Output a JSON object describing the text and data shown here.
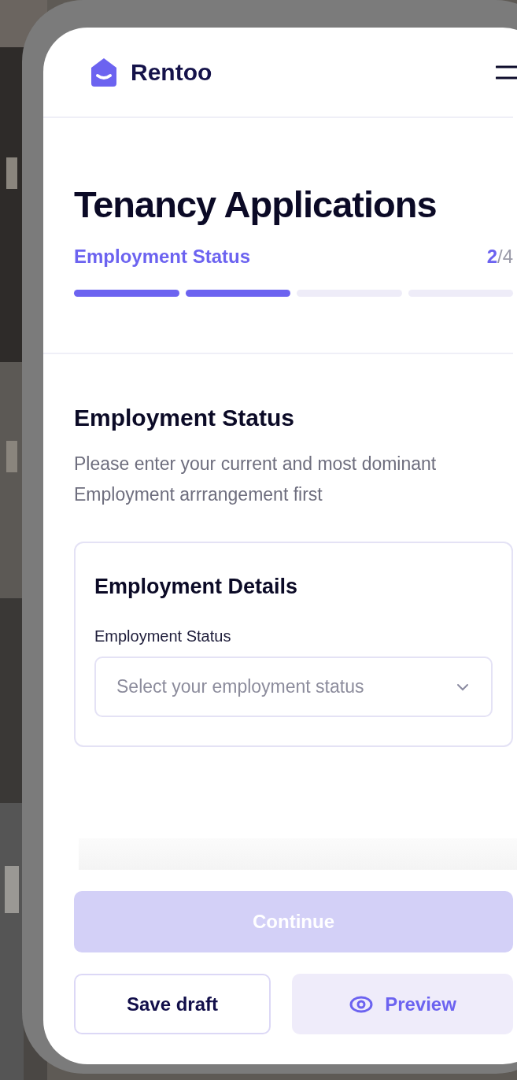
{
  "header": {
    "brand": "Rentoo"
  },
  "page": {
    "title": "Tenancy Applications",
    "step_label": "Employment Status",
    "step_current": "2",
    "step_total": "/4",
    "steps": [
      {
        "completed": true
      },
      {
        "completed": true
      },
      {
        "completed": false
      },
      {
        "completed": false
      }
    ]
  },
  "section": {
    "title": "Employment Status",
    "description": "Please  enter your current and most dominant Employment arrrangement first"
  },
  "card": {
    "title": "Employment Details",
    "field_label": "Employment Status",
    "select_placeholder": "Select your employment status"
  },
  "actions": {
    "continue": {
      "label": "Continue",
      "disabled": true
    },
    "save_draft": "Save draft",
    "preview": "Preview"
  }
}
